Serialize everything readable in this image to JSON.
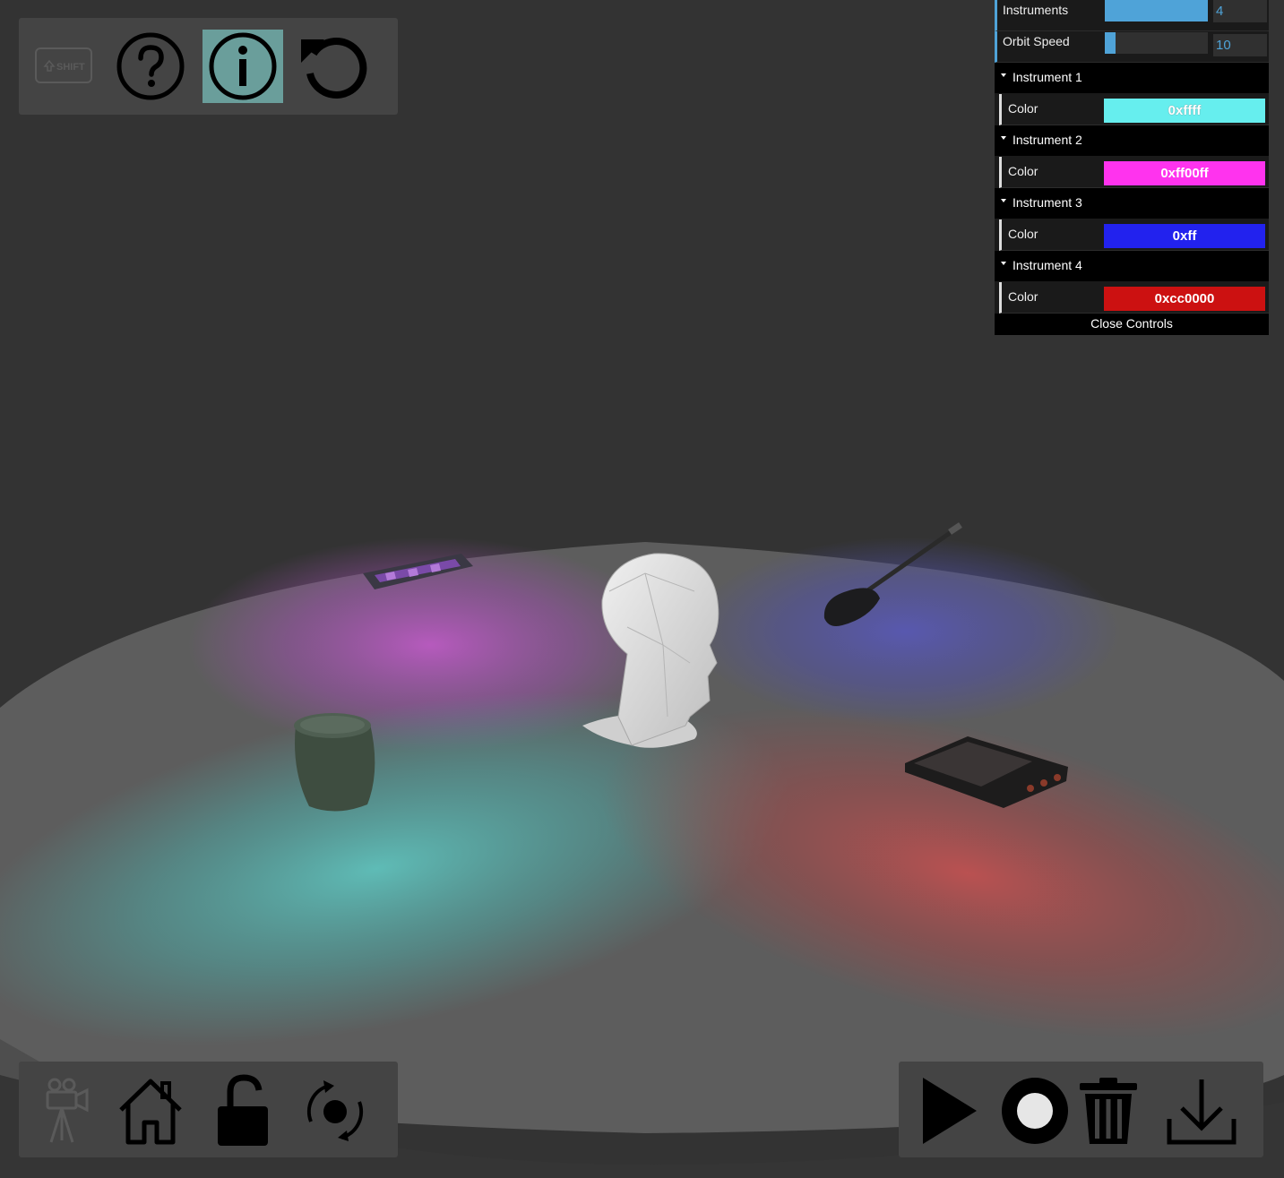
{
  "gui": {
    "instruments_label": "Instruments",
    "instruments_value": "4",
    "instruments_fraction": 1.0,
    "orbit_label": "Orbit Speed",
    "orbit_value": "10",
    "orbit_fraction": 0.1,
    "folders": [
      {
        "title": "Instrument 1",
        "color_label": "Color",
        "color_value": "0xffff",
        "swatch": "#66eeee"
      },
      {
        "title": "Instrument 2",
        "color_label": "Color",
        "color_value": "0xff00ff",
        "swatch": "#ff33ee"
      },
      {
        "title": "Instrument 3",
        "color_label": "Color",
        "color_value": "0xff",
        "swatch": "#2222ee"
      },
      {
        "title": "Instrument 4",
        "color_label": "Color",
        "color_value": "0xcc0000",
        "swatch": "#cc1111"
      }
    ],
    "close_label": "Close Controls"
  },
  "toolbar_top": {
    "shift_label": "SHIFT",
    "icons": [
      "shift-key-icon",
      "help-icon",
      "info-icon",
      "reset-icon"
    ],
    "active_button": "info"
  },
  "toolbar_bottom_left": {
    "icons": [
      "camera-icon",
      "home-icon",
      "unlock-icon",
      "orbit-icon"
    ]
  },
  "toolbar_bottom_right": {
    "icons": [
      "play-icon",
      "record-icon",
      "trash-icon",
      "download-icon"
    ]
  },
  "colors": {
    "background": "#333333",
    "toolbar": "#444444",
    "active_highlight": "#6a9e9b",
    "slider_accent": "#4fa3d8"
  }
}
